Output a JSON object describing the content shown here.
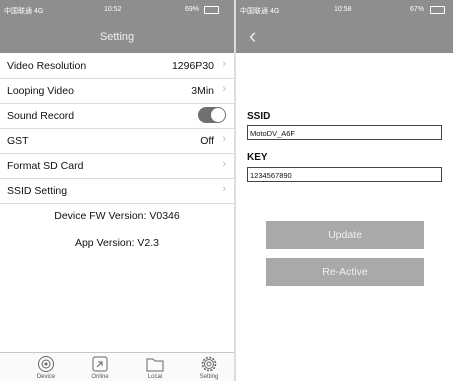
{
  "left_screen": {
    "status": {
      "carrier": "中国联通 4G",
      "time": "10:52",
      "battery": "69%"
    },
    "title": "Setting",
    "settings": [
      {
        "label": "Video Resolution",
        "value": "1296P30"
      },
      {
        "label": "Looping Video",
        "value": "3Min"
      },
      {
        "label": "Sound Record",
        "value": "on"
      },
      {
        "label": "GST",
        "value": "Off"
      },
      {
        "label": "Format SD Card",
        "value": ""
      },
      {
        "label": "SSID Setting",
        "value": ""
      }
    ],
    "device_fw_version": "Device FW Version: V0346",
    "app_version": "App Version: V2.3",
    "tabs": [
      {
        "label": "Device",
        "icon": "camera-icon"
      },
      {
        "label": "Online",
        "icon": "online-icon"
      },
      {
        "label": "Local",
        "icon": "folder-icon"
      },
      {
        "label": "Setting",
        "icon": "gear-icon"
      }
    ]
  },
  "right_screen": {
    "status": {
      "carrier": "中国联通 4G",
      "time": "10:58",
      "battery": "67%"
    },
    "back_icon": "chevron-left-icon",
    "ssid_label": "SSID",
    "ssid_value": "MotoDV_A6F",
    "key_label": "KEY",
    "key_value": "1234567890",
    "update_button": "Update",
    "reactive_button": "Re-Active"
  },
  "colors": {
    "navbar": "#8e8e8e",
    "button": "#a9a9a9",
    "toggle_on": "#707070"
  }
}
